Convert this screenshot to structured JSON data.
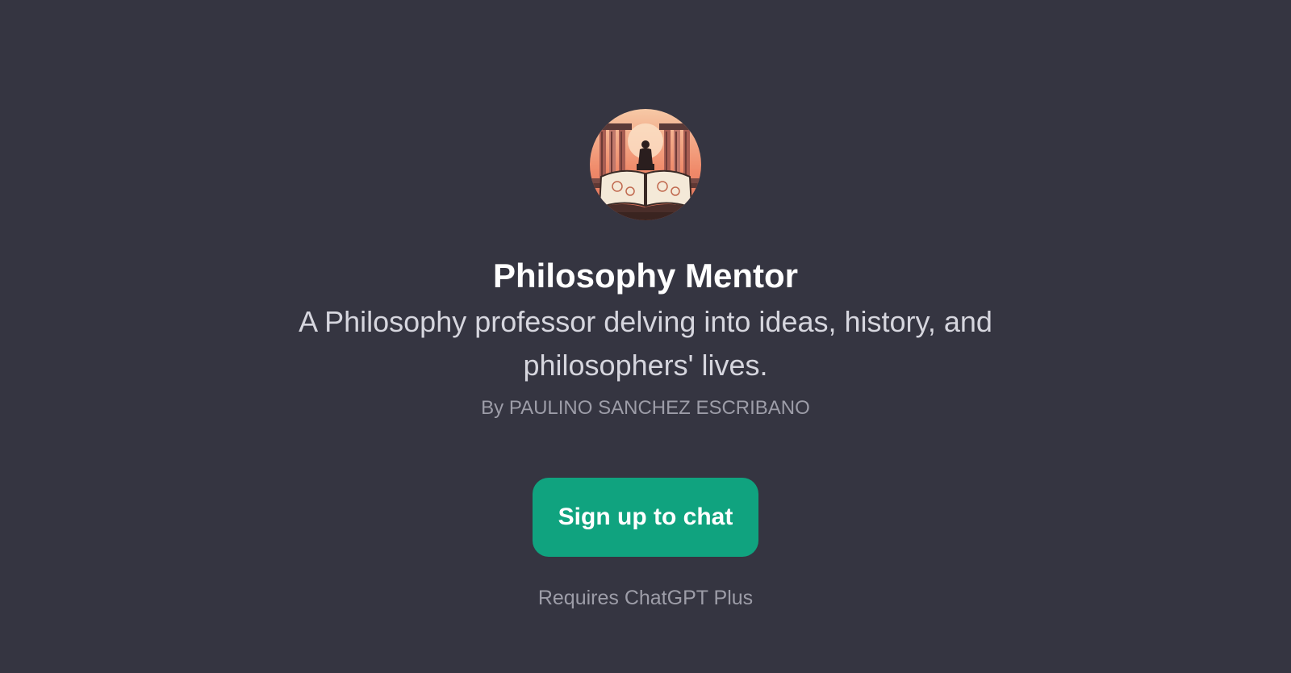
{
  "gpt": {
    "title": "Philosophy Mentor",
    "description": "A Philosophy professor delving into ideas, history, and philosophers' lives.",
    "author": "By PAULINO SANCHEZ ESCRIBANO",
    "avatar_icon": "philosophy-book-columns-icon"
  },
  "cta": {
    "signup_label": "Sign up to chat",
    "requirement": "Requires ChatGPT Plus"
  },
  "colors": {
    "background": "#353541",
    "accent": "#10a37f",
    "title": "#ffffff",
    "muted": "#9d9da8"
  }
}
